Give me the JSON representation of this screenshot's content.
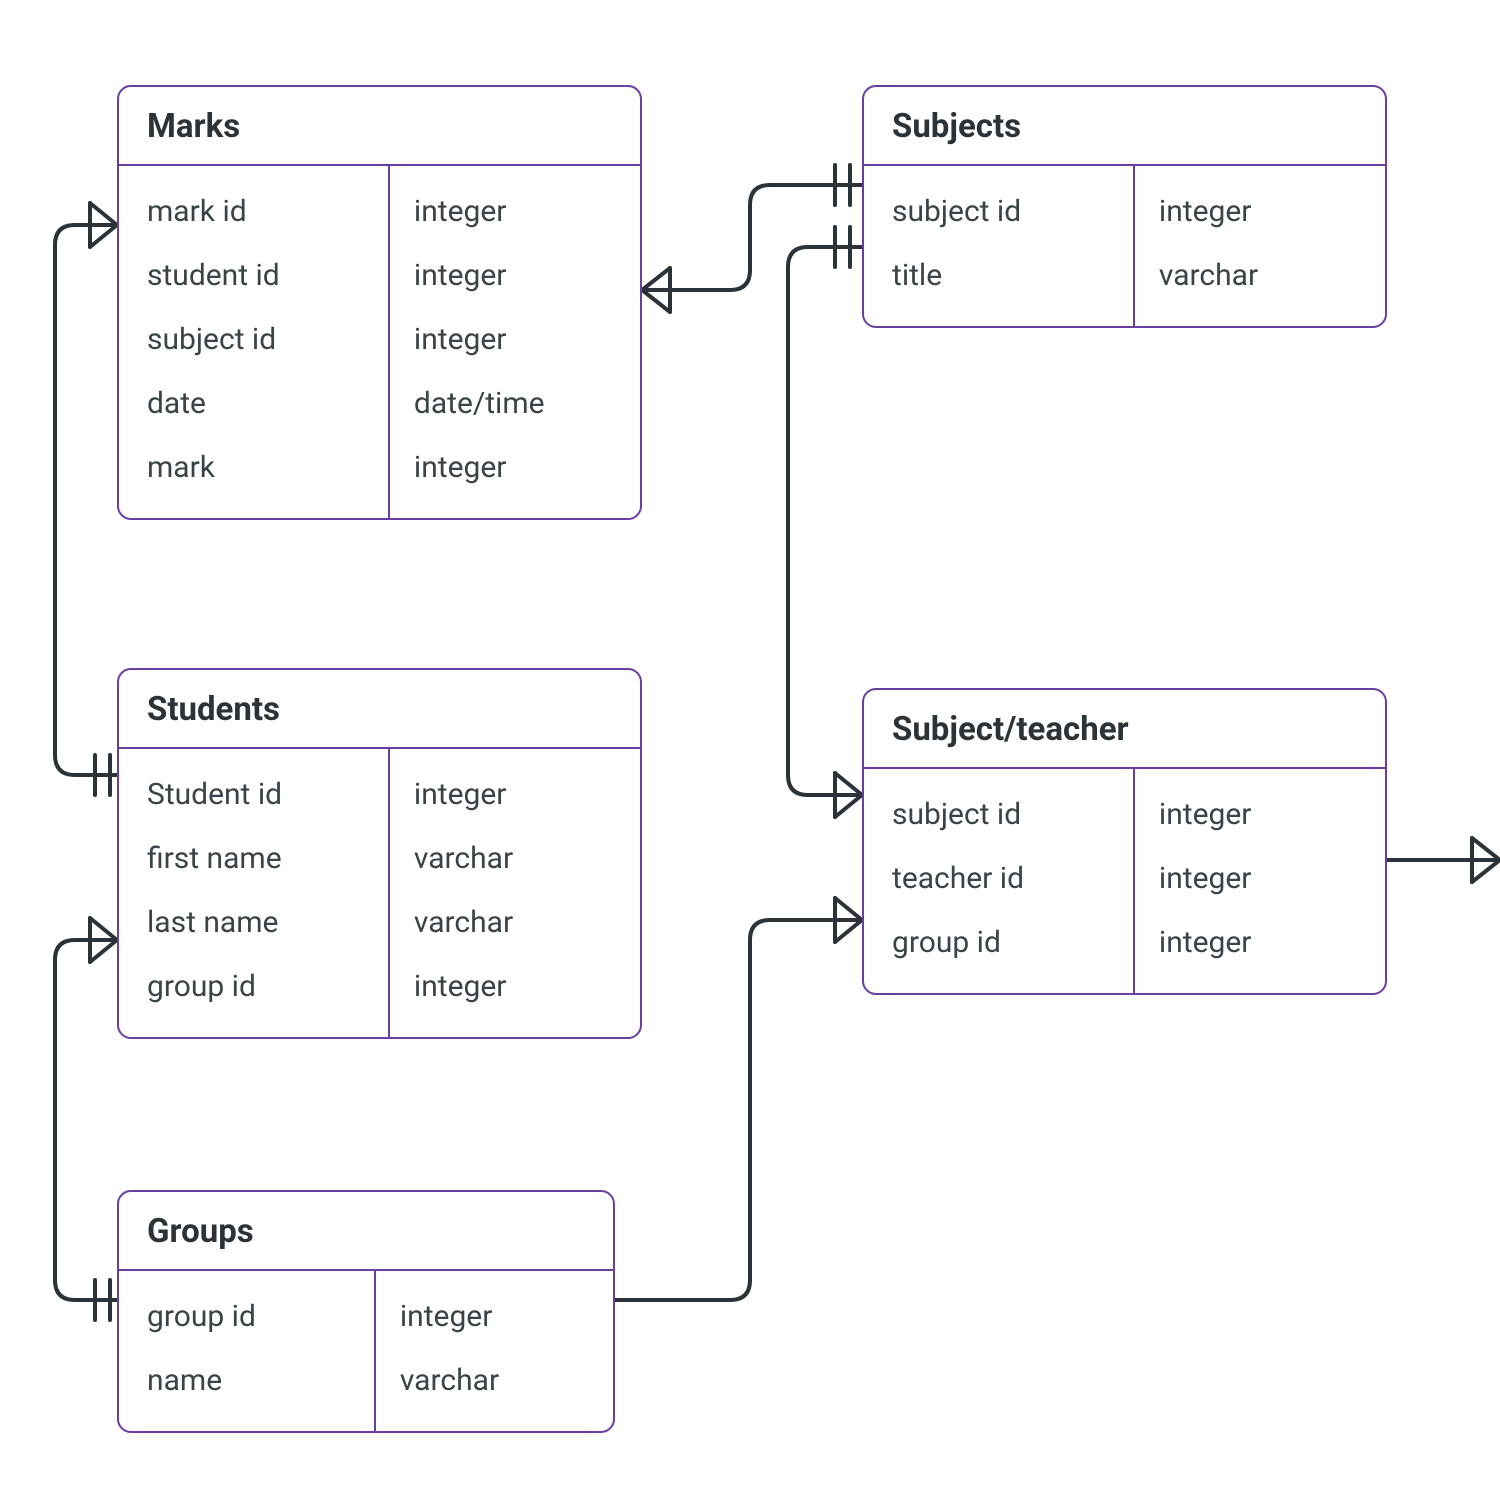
{
  "entities": {
    "marks": {
      "title": "Marks",
      "fields": [
        {
          "name": "mark id",
          "type": "integer"
        },
        {
          "name": "student id",
          "type": "integer"
        },
        {
          "name": "subject id",
          "type": "integer"
        },
        {
          "name": "date",
          "type": "date/time"
        },
        {
          "name": "mark",
          "type": "integer"
        }
      ]
    },
    "subjects": {
      "title": "Subjects",
      "fields": [
        {
          "name": "subject id",
          "type": "integer"
        },
        {
          "name": "title",
          "type": "varchar"
        }
      ]
    },
    "students": {
      "title": "Students",
      "fields": [
        {
          "name": "Student id",
          "type": "integer"
        },
        {
          "name": "first name",
          "type": "varchar"
        },
        {
          "name": "last name",
          "type": "varchar"
        },
        {
          "name": "group id",
          "type": "integer"
        }
      ]
    },
    "subjectTeacher": {
      "title": "Subject/teacher",
      "fields": [
        {
          "name": "subject id",
          "type": "integer"
        },
        {
          "name": "teacher id",
          "type": "integer"
        },
        {
          "name": "group id",
          "type": "integer"
        }
      ]
    },
    "groups": {
      "title": "Groups",
      "fields": [
        {
          "name": "group id",
          "type": "integer"
        },
        {
          "name": "name",
          "type": "varchar"
        }
      ]
    }
  },
  "colors": {
    "border": "#6b3fa0",
    "connector": "#2c3338",
    "text": "#3a4347"
  }
}
